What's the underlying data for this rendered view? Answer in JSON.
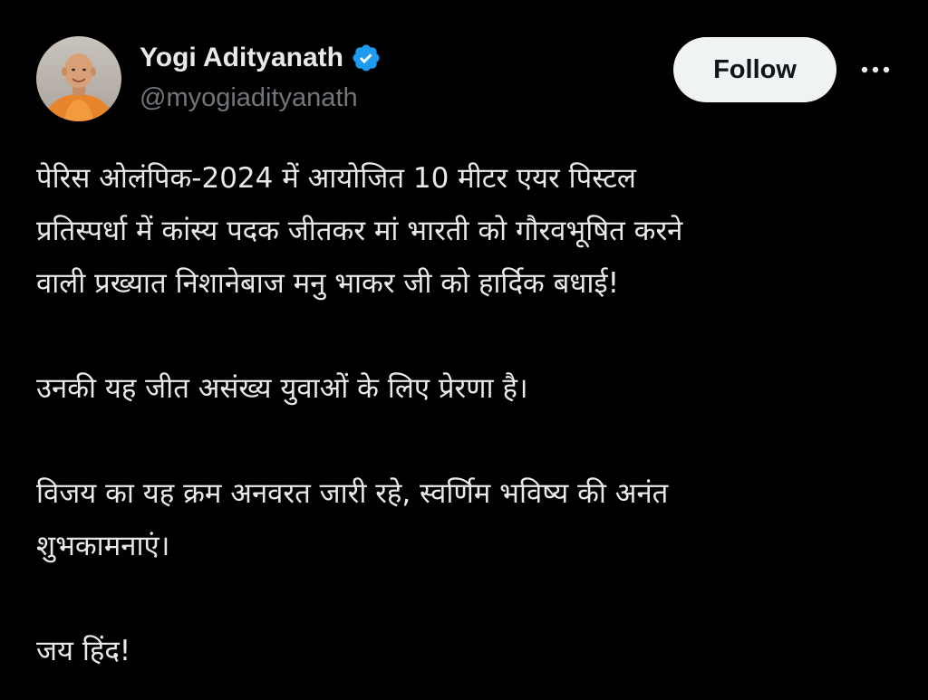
{
  "tweet": {
    "author": {
      "display_name": "Yogi Adityanath",
      "handle": "@myogiadityanath",
      "verified_icon": "verified-badge-icon",
      "avatar": "profile-photo"
    },
    "follow_label": "Follow",
    "more_icon": "more-horizontal-icon",
    "paragraphs": [
      {
        "lines": [
          "पेरिस ओलंपिक-2024 में आयोजित 10 मीटर एयर पिस्टल",
          "प्रतिस्पर्धा में कांस्य पदक जीतकर मां भारती को गौरवभूषित करने",
          "वाली प्रख्यात निशानेबाज मनु भाकर जी को हार्दिक बधाई!"
        ]
      },
      {
        "lines": [
          "उनकी यह जीत असंख्य युवाओं के लिए प्रेरणा है।"
        ]
      },
      {
        "lines": [
          "विजय का यह क्रम अनवरत जारी रहे, स्वर्णिम भविष्य की अनंत",
          "शुभकामनाएं।"
        ]
      },
      {
        "lines": [
          "जय हिंद!"
        ]
      }
    ]
  },
  "colors": {
    "background": "#000000",
    "primary_text": "#e7e9ea",
    "secondary_text": "#71767b",
    "follow_button_bg": "#eff3f4",
    "follow_button_text": "#0f1419",
    "verified_blue": "#1d9bf0"
  }
}
